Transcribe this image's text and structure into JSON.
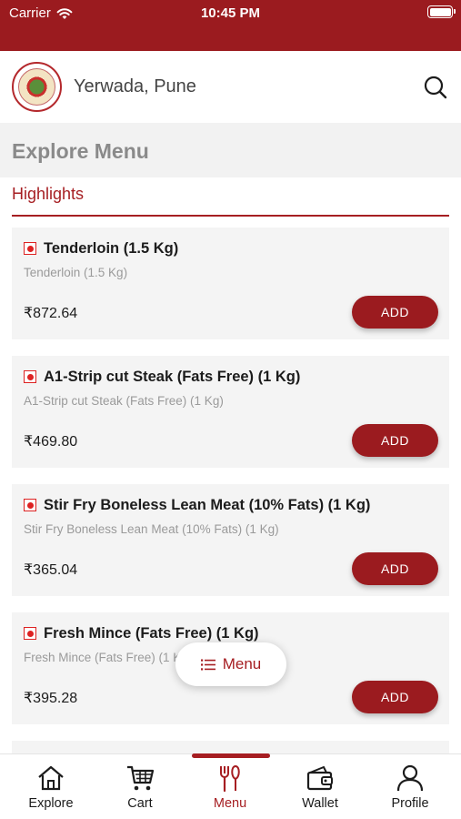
{
  "status_bar": {
    "carrier": "Carrier",
    "time": "10:45 PM"
  },
  "header": {
    "location": "Yerwada, Pune"
  },
  "section_title": "Explore Menu",
  "category_tab": "Highlights",
  "items": [
    {
      "name": "Tenderloin (1.5 Kg)",
      "description": "Tenderloin (1.5 Kg)",
      "price": "₹872.64",
      "button": "ADD"
    },
    {
      "name": "A1-Strip cut Steak (Fats Free) (1 Kg)",
      "description": "A1-Strip cut Steak (Fats Free) (1 Kg)",
      "price": "₹469.80",
      "button": "ADD"
    },
    {
      "name": "Stir Fry Boneless Lean Meat (10% Fats) (1 Kg)",
      "description": "Stir Fry Boneless Lean Meat (10% Fats) (1 Kg)",
      "price": "₹365.04",
      "button": "ADD"
    },
    {
      "name": "Fresh Mince (Fats Free) (1 Kg)",
      "description": "Fresh Mince (Fats Free) (1 Kg)",
      "price": "₹395.28",
      "button": "ADD"
    }
  ],
  "menu_button": {
    "label": "Menu",
    "icon": "list-icon"
  },
  "tabs": [
    {
      "label": "Explore",
      "icon": "home-icon"
    },
    {
      "label": "Cart",
      "icon": "cart-icon"
    },
    {
      "label": "Menu",
      "icon": "fork-knife-icon",
      "active": true
    },
    {
      "label": "Wallet",
      "icon": "wallet-icon"
    },
    {
      "label": "Profile",
      "icon": "person-icon"
    }
  ],
  "colors": {
    "brand": "#9b1b1f",
    "accent": "#a61e22"
  }
}
